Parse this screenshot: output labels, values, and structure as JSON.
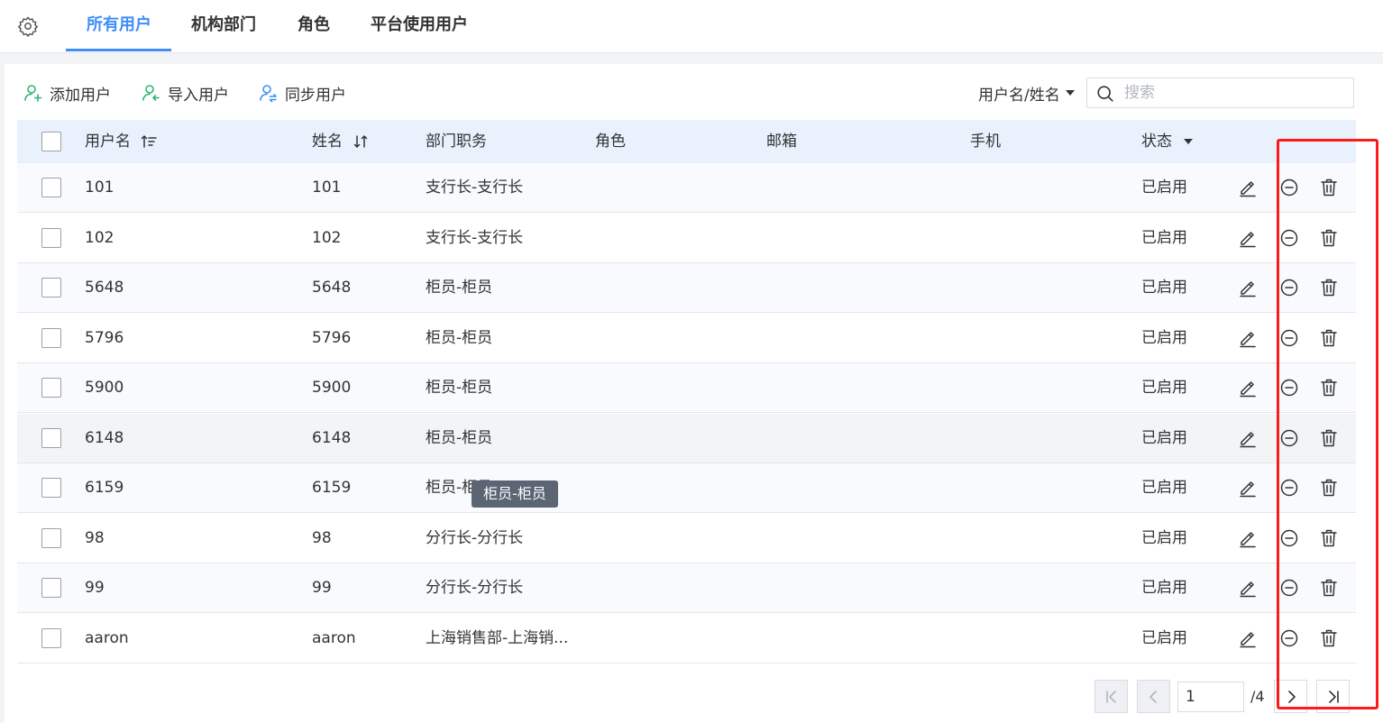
{
  "tabs": [
    {
      "label": "所有用户",
      "active": true
    },
    {
      "label": "机构部门",
      "active": false
    },
    {
      "label": "角色",
      "active": false
    },
    {
      "label": "平台使用用户",
      "active": false
    }
  ],
  "toolbar": {
    "add_label": "添加用户",
    "import_label": "导入用户",
    "sync_label": "同步用户",
    "filter_label": "用户名/姓名",
    "search_placeholder": "搜索"
  },
  "table": {
    "columns": [
      "用户名",
      "姓名",
      "部门职务",
      "角色",
      "邮箱",
      "手机",
      "状态"
    ],
    "rows": [
      {
        "username": "101",
        "name": "101",
        "dept": "支行长-支行长",
        "status": "已启用"
      },
      {
        "username": "102",
        "name": "102",
        "dept": "支行长-支行长",
        "status": "已启用"
      },
      {
        "username": "5648",
        "name": "5648",
        "dept": "柜员-柜员",
        "status": "已启用"
      },
      {
        "username": "5796",
        "name": "5796",
        "dept": "柜员-柜员",
        "status": "已启用"
      },
      {
        "username": "5900",
        "name": "5900",
        "dept": "柜员-柜员",
        "status": "已启用"
      },
      {
        "username": "6148",
        "name": "6148",
        "dept": "柜员-柜员",
        "status": "已启用"
      },
      {
        "username": "6159",
        "name": "6159",
        "dept": "柜员-柜员",
        "status": "已启用"
      },
      {
        "username": "98",
        "name": "98",
        "dept": "分行长-分行长",
        "status": "已启用"
      },
      {
        "username": "99",
        "name": "99",
        "dept": "分行长-分行长",
        "status": "已启用"
      },
      {
        "username": "aaron",
        "name": "aaron",
        "dept": "上海销售部-上海销...",
        "status": "已启用"
      }
    ],
    "hovered_row": 5,
    "tooltip": "柜员-柜员"
  },
  "pagination": {
    "current_page": "1",
    "total_label": "/4"
  },
  "colors": {
    "accent": "#3e8ef7",
    "add_icon": "#2bb673",
    "highlight": "#ff1a1a",
    "header_bg": "#e8f1fc"
  },
  "icons": [
    "gear-icon",
    "add-user-icon",
    "import-user-icon",
    "sync-user-icon",
    "caret-down-icon",
    "search-icon",
    "sort-icon",
    "edit-icon",
    "disable-icon",
    "delete-icon",
    "first-page-icon",
    "prev-page-icon",
    "next-page-icon",
    "last-page-icon"
  ]
}
